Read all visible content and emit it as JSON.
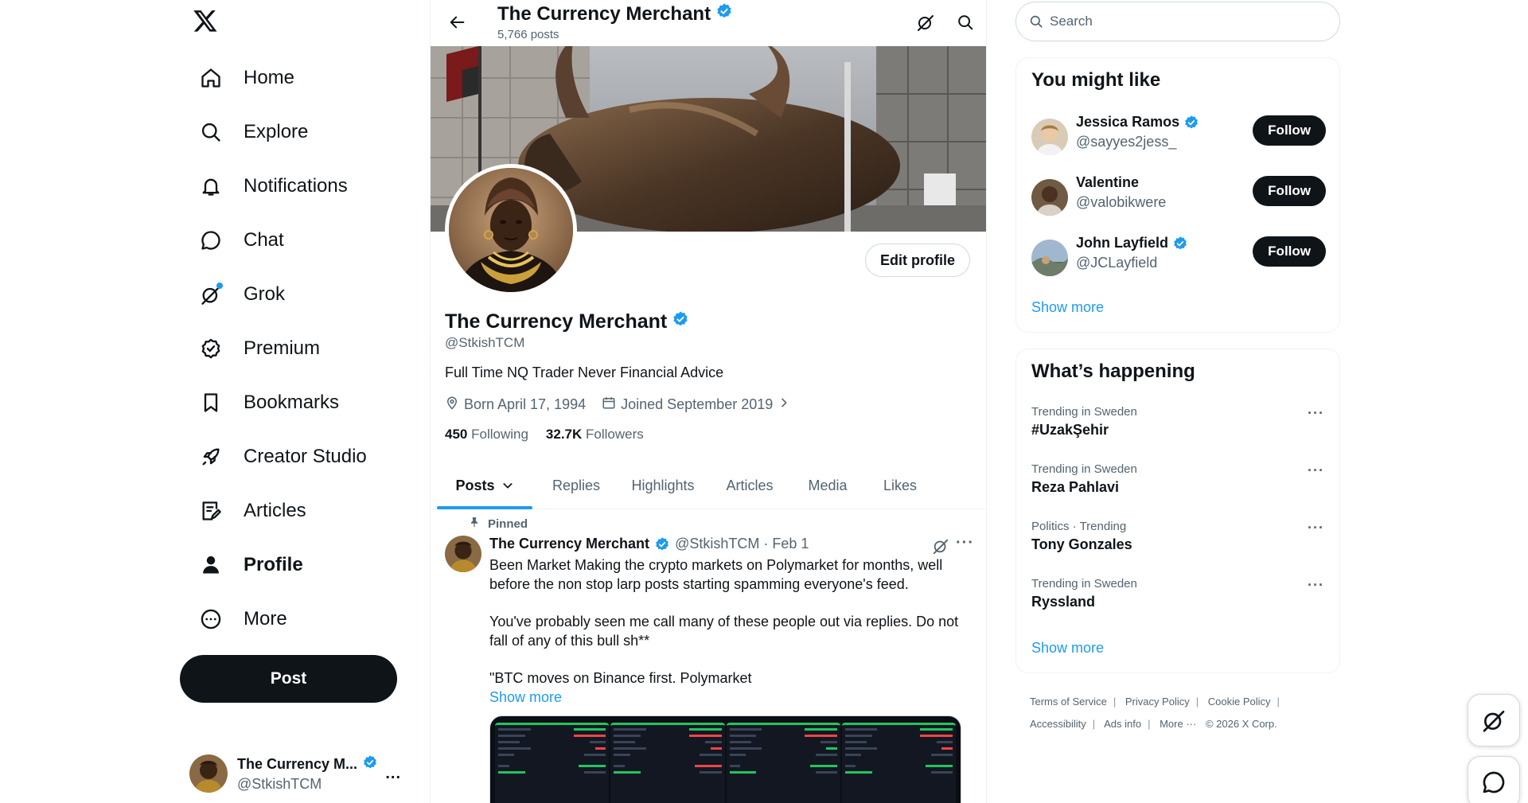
{
  "nav": {
    "items": [
      {
        "label": "Home",
        "icon": "home-icon"
      },
      {
        "label": "Explore",
        "icon": "search-icon"
      },
      {
        "label": "Notifications",
        "icon": "bell-icon"
      },
      {
        "label": "Chat",
        "icon": "chat-icon"
      },
      {
        "label": "Grok",
        "icon": "grok-icon"
      },
      {
        "label": "Premium",
        "icon": "verified-icon"
      },
      {
        "label": "Bookmarks",
        "icon": "bookmark-icon"
      },
      {
        "label": "Creator Studio",
        "icon": "rocket-icon"
      },
      {
        "label": "Articles",
        "icon": "article-icon"
      },
      {
        "label": "Profile",
        "icon": "person-icon"
      },
      {
        "label": "More",
        "icon": "more-circle-icon"
      }
    ],
    "post_label": "Post",
    "account": {
      "name": "The Currency M...",
      "handle": "@StkishTCM",
      "menu": "..."
    }
  },
  "header": {
    "title": "The Currency Merchant",
    "posts_count": "5,766 posts"
  },
  "profile": {
    "name": "The Currency Merchant",
    "handle": "@StkishTCM",
    "bio": "Full Time NQ Trader Never Financial Advice",
    "born": "Born April 17, 1994",
    "joined": "Joined September 2019",
    "following_count": "450",
    "following_label": "Following",
    "followers_count": "32.7K",
    "followers_label": "Followers",
    "edit_label": "Edit profile"
  },
  "tabs": [
    "Posts",
    "Replies",
    "Highlights",
    "Articles",
    "Media",
    "Likes"
  ],
  "tweet": {
    "pinned_label": "Pinned",
    "author": "The Currency Merchant",
    "handle_date": "@StkishTCM · Feb 1",
    "line1": "Been Market Making the crypto markets on Polymarket for months, well",
    "line2": "before the non stop larp posts starting spamming everyone's feed.",
    "line3": "You've probably seen me call many of these people out via replies. Do not",
    "line4": "fall of any of this bull sh**",
    "line5": "\"BTC moves on Binance first. Polymarket",
    "show_more": "Show more"
  },
  "search": {
    "placeholder": "Search"
  },
  "who_to_follow": {
    "title": "You might like",
    "users": [
      {
        "name": "Jessica Ramos",
        "handle": "@sayyes2jess_",
        "verified": true,
        "button": "Follow"
      },
      {
        "name": "Valentine",
        "handle": "@valobikwere",
        "verified": false,
        "button": "Follow"
      },
      {
        "name": "John Layfield",
        "handle": "@JCLayfield",
        "verified": true,
        "button": "Follow"
      }
    ],
    "show_more": "Show more"
  },
  "trends": {
    "title": "What’s happening",
    "items": [
      {
        "context": "Trending in Sweden",
        "title": "#UzakŞehir"
      },
      {
        "context": "Trending in Sweden",
        "title": "Reza Pahlavi"
      },
      {
        "context": "Politics · Trending",
        "title": "Tony Gonzales"
      },
      {
        "context": "Trending in Sweden",
        "title": "Ryssland"
      }
    ],
    "show_more": "Show more"
  },
  "footer": {
    "links": [
      "Terms of Service",
      "Privacy Policy",
      "Cookie Policy",
      "Accessibility",
      "Ads info",
      "More ···"
    ],
    "copyright": "© 2026 X Corp."
  },
  "colors": {
    "accent": "#1d9bf0",
    "text": "#0f1419",
    "muted": "#536471",
    "border": "#eff3f4"
  }
}
